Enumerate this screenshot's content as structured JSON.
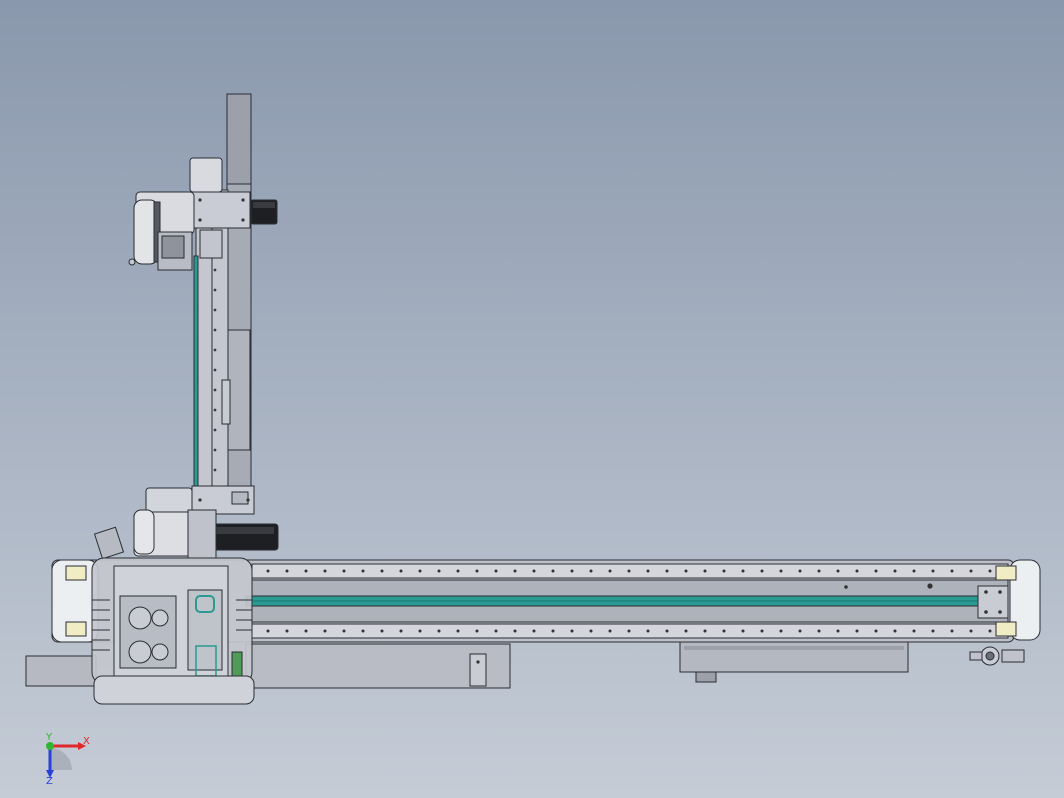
{
  "viewport": {
    "background_top": "#8a98ad",
    "background_bottom": "#c5ccd6"
  },
  "model": {
    "frame_color": "#b9bcc5",
    "frame_dark": "#9fa3ad",
    "outline_color": "#2a2d33",
    "accent_rail_color": "#2a9a93",
    "end_cap_color": "#f0ecc4",
    "motor_color": "#1e1f23"
  },
  "triad": {
    "x_label": "X",
    "y_label": "Y",
    "z_label": "Z",
    "x_color": "#e0282a",
    "y_color": "#2fb52f",
    "z_color": "#2640d8"
  }
}
